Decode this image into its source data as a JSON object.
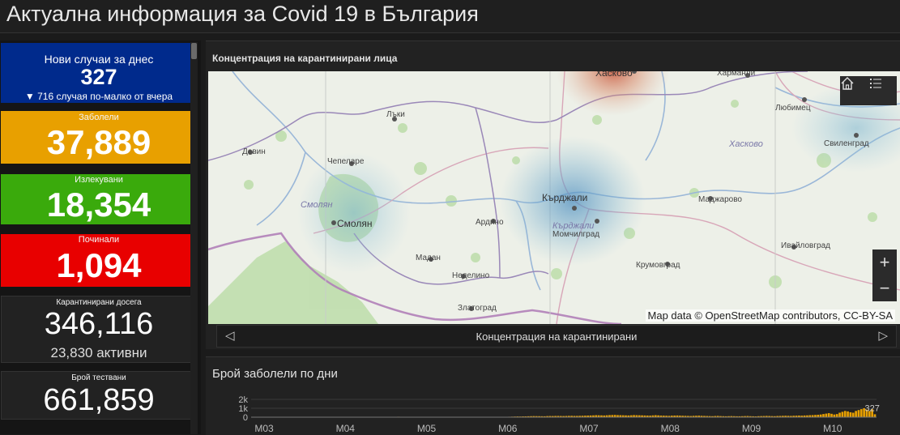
{
  "header": {
    "title": "Актуална информация за Covid 19 в България"
  },
  "cards": {
    "new_cases": {
      "label": "Нови случаи за днес",
      "value": "327",
      "note": "▼ 716 случая по-малко от вчера",
      "color": "#002a8c"
    },
    "infected": {
      "label": "Заболели",
      "value": "37,889",
      "color": "#e8a000"
    },
    "recovered": {
      "label": "Излекувани",
      "value": "18,354",
      "color": "#3aaa0c"
    },
    "deaths": {
      "label": "Починали",
      "value": "1,094",
      "color": "#e80000"
    },
    "quarantined": {
      "label": "Карантинирани досега",
      "value": "346,116",
      "sub": "23,830 активни"
    },
    "tests": {
      "label": "Брой тествани",
      "value": "661,859"
    }
  },
  "map_panel": {
    "title": "Концентрация на карантинирани лица",
    "attribution": "Map data © OpenStreetMap contributors, CC-BY-SA",
    "home_icon": "home-icon",
    "layers_icon": "list-icon",
    "zoom_in": "+",
    "zoom_out": "−",
    "pager_label": "Концентрация на карантинирани",
    "places": {
      "haskovo_top": "Хасково",
      "harmanli": "Харманли",
      "lyubimets": "Любимец",
      "haskovo_region": "Хасково",
      "svilengrad": "Свиленград",
      "devin": "Девин",
      "lyki": "Лъки",
      "chepelare": "Чепеларе",
      "smolyan_region": "Смолян",
      "smolyan": "Смолян",
      "kardzhali": "Кърджали",
      "kardzhali_region": "Кърджали",
      "madzharovo": "Маджарово",
      "ardino": "Ардино",
      "momchilgrad": "Момчилград",
      "ivaylovgrad": "Ивайловград",
      "madan": "Мадан",
      "krumovgrad": "Крумовград",
      "nedelino": "Неделино",
      "zlatograd": "Златоград"
    }
  },
  "chart_panel": {
    "title": "Брой заболели по дни"
  },
  "chart_data": {
    "type": "bar",
    "title": "Брой заболели по дни",
    "y_ticks": [
      "2k",
      "1k",
      "0"
    ],
    "ylim": [
      0,
      2000
    ],
    "x_ticks": [
      "M03",
      "M04",
      "M05",
      "M06",
      "M07",
      "M08",
      "M09",
      "M10"
    ],
    "bar_color": "#e8a000",
    "last_label": "327",
    "monthly_levels": [
      {
        "month": "M03",
        "values": [
          2,
          3,
          1,
          4,
          6,
          10,
          12,
          15,
          20,
          25,
          28,
          30,
          35,
          40,
          45,
          40,
          38,
          36,
          30,
          28,
          30,
          32,
          35,
          28,
          26,
          30,
          35,
          25,
          28,
          30
        ]
      },
      {
        "month": "M04",
        "values": [
          30,
          28,
          35,
          40,
          42,
          38,
          30,
          28,
          25,
          33,
          40,
          45,
          35,
          30,
          28,
          26,
          30,
          35,
          40,
          38,
          36,
          30,
          28,
          40,
          50,
          45,
          42,
          38,
          35,
          30
        ]
      },
      {
        "month": "M05",
        "values": [
          25,
          28,
          30,
          35,
          30,
          28,
          25,
          22,
          20,
          18,
          22,
          25,
          30,
          28,
          25,
          22,
          20,
          18,
          15,
          18,
          20,
          22,
          25,
          20,
          18,
          15,
          16,
          18,
          20,
          22
        ]
      },
      {
        "month": "M06",
        "values": [
          20,
          25,
          30,
          35,
          40,
          50,
          60,
          70,
          80,
          75,
          85,
          90,
          100,
          110,
          120,
          115,
          110,
          105,
          100,
          120,
          130,
          125,
          135,
          140,
          130,
          125,
          135,
          145,
          150,
          140
        ]
      },
      {
        "month": "M07",
        "values": [
          140,
          150,
          160,
          170,
          180,
          190,
          200,
          220,
          210,
          200,
          190,
          210,
          230,
          240,
          250,
          230,
          220,
          210,
          200,
          190,
          210,
          230,
          220,
          210,
          200,
          190,
          180,
          170,
          200,
          220
        ]
      },
      {
        "month": "M08",
        "values": [
          200,
          180,
          170,
          160,
          150,
          170,
          180,
          190,
          170,
          160,
          150,
          140,
          130,
          150,
          160,
          170,
          150,
          140,
          130,
          120,
          110,
          130,
          140,
          120,
          110,
          100,
          110,
          120,
          110,
          100
        ]
      },
      {
        "month": "M09",
        "values": [
          100,
          110,
          120,
          130,
          110,
          100,
          90,
          110,
          120,
          130,
          140,
          130,
          120,
          110,
          130,
          140,
          150,
          160,
          150,
          140,
          160,
          170,
          180,
          170,
          190,
          200,
          220,
          230,
          250,
          270
        ]
      },
      {
        "month": "M10",
        "values": [
          300,
          350,
          400,
          450,
          380,
          300,
          350,
          500,
          600,
          700,
          650,
          550,
          500,
          700,
          800,
          900,
          1000,
          850,
          700,
          900,
          327
        ]
      }
    ]
  }
}
